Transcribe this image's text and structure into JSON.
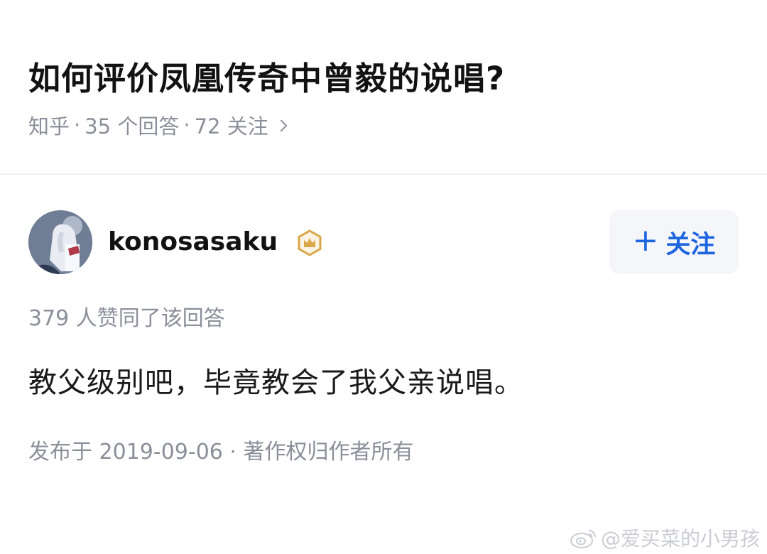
{
  "question": {
    "title": "如何评价凤凰传奇中曾毅的说唱?",
    "source": "知乎",
    "answers": "35 个回答",
    "followers": "72 关注",
    "separator": "·"
  },
  "answer": {
    "author": {
      "name": "konosasaku",
      "badge_icon": "crown-badge-icon"
    },
    "follow_label": "关注",
    "likes_text": "379 人赞同了该回答",
    "content": "教父级别吧，毕竟教会了我父亲说唱。",
    "published": "发布于 2019-09-06 · 著作权归作者所有"
  },
  "watermark": {
    "text": "@爱买菜的小男孩",
    "icon": "weibo-icon"
  },
  "colors": {
    "accent": "#1d64e0",
    "meta_text": "#8a8f99",
    "badge": "#d9a74a",
    "follow_bg": "#f4f6f9"
  }
}
